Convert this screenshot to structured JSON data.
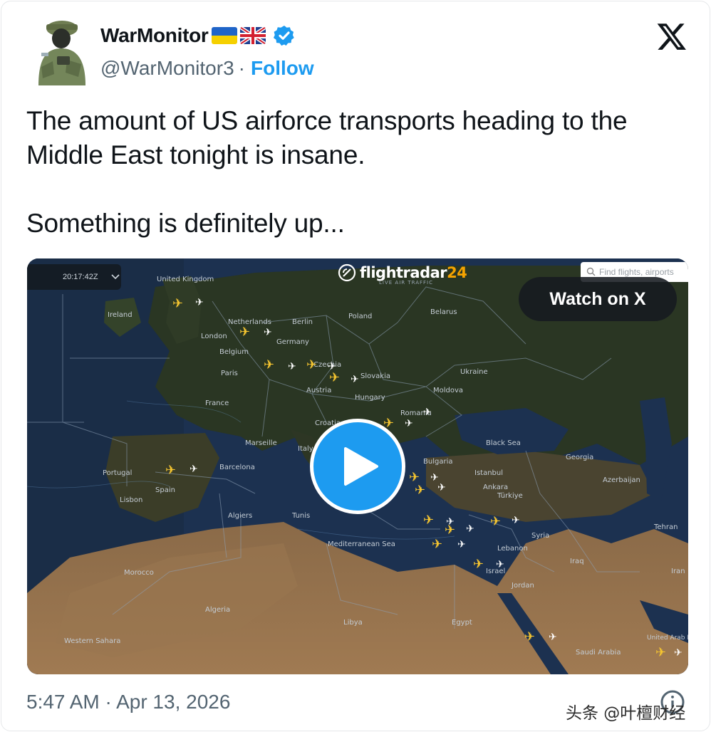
{
  "tweet": {
    "author": {
      "display_name": "WarMonitor",
      "flags": [
        "ukraine-flag",
        "uk-flag"
      ],
      "verified": true,
      "handle": "@WarMonitor3",
      "separator": "·",
      "follow_label": "Follow"
    },
    "text_lines": [
      "The amount of US airforce transports heading to the",
      "Middle East tonight is insane.",
      "Something is definitely up..."
    ],
    "timestamp": "5:47 AM · Apr 13, 2026",
    "platform_icon": "x-logo-icon"
  },
  "media": {
    "watch_label": "Watch on X",
    "brand": "flightradar",
    "brand_number": "24",
    "brand_sub": "LIVE AIR TRAFFIC",
    "time_readout": "20:17:42Z",
    "search_placeholder": "Find flights, airports",
    "play_icon": "play-icon",
    "map_labels": {
      "united_kingdom": "United Kingdom",
      "ireland": "Ireland",
      "netherlands": "Netherlands",
      "berlin": "Berlin",
      "poland": "Poland",
      "belarus": "Belarus",
      "london": "London",
      "germany": "Germany",
      "belgium": "Belgium",
      "paris": "Paris",
      "czechia": "Czechia",
      "slovakia": "Slovakia",
      "ukraine": "Ukraine",
      "austria": "Austria",
      "hungary": "Hungary",
      "moldova": "Moldova",
      "france": "France",
      "romania": "Romania",
      "croatia": "Croatia",
      "marseille": "Marseille",
      "italy": "Italy",
      "black_sea": "Black Sea",
      "georgia": "Georgia",
      "portugal": "Portugal",
      "barcelona": "Barcelona",
      "bulgaria": "Bulgaria",
      "istanbul": "Istanbul",
      "spain": "Spain",
      "lisbon": "Lisbon",
      "ankara": "Ankara",
      "azerbaijan": "Azerbaijan",
      "turkiye": "Türkiye",
      "algiers": "Algiers",
      "tunis": "Tunis",
      "tehran": "Tehran",
      "syria": "Syria",
      "mediterranean": "Mediterranean Sea",
      "lebanon": "Lebanon",
      "iraq": "Iraq",
      "morocco": "Morocco",
      "israel": "Israel",
      "jordan": "Jordan",
      "iran": "Iran",
      "algeria": "Algeria",
      "libya": "Libya",
      "egypt": "Egypt",
      "western_sahara": "Western Sahara",
      "saudi_arabia": "Saudi Arabia",
      "uae": "United Arab Emirates"
    }
  },
  "watermark": "头条 @叶檀财经",
  "colors": {
    "follow": "#1d9bf0",
    "play_button": "#1d9bf0",
    "verified": "#1d9bf0",
    "secondary_text": "#536471",
    "plane_yellow": "#f4c430",
    "plane_white": "#ffffff"
  }
}
